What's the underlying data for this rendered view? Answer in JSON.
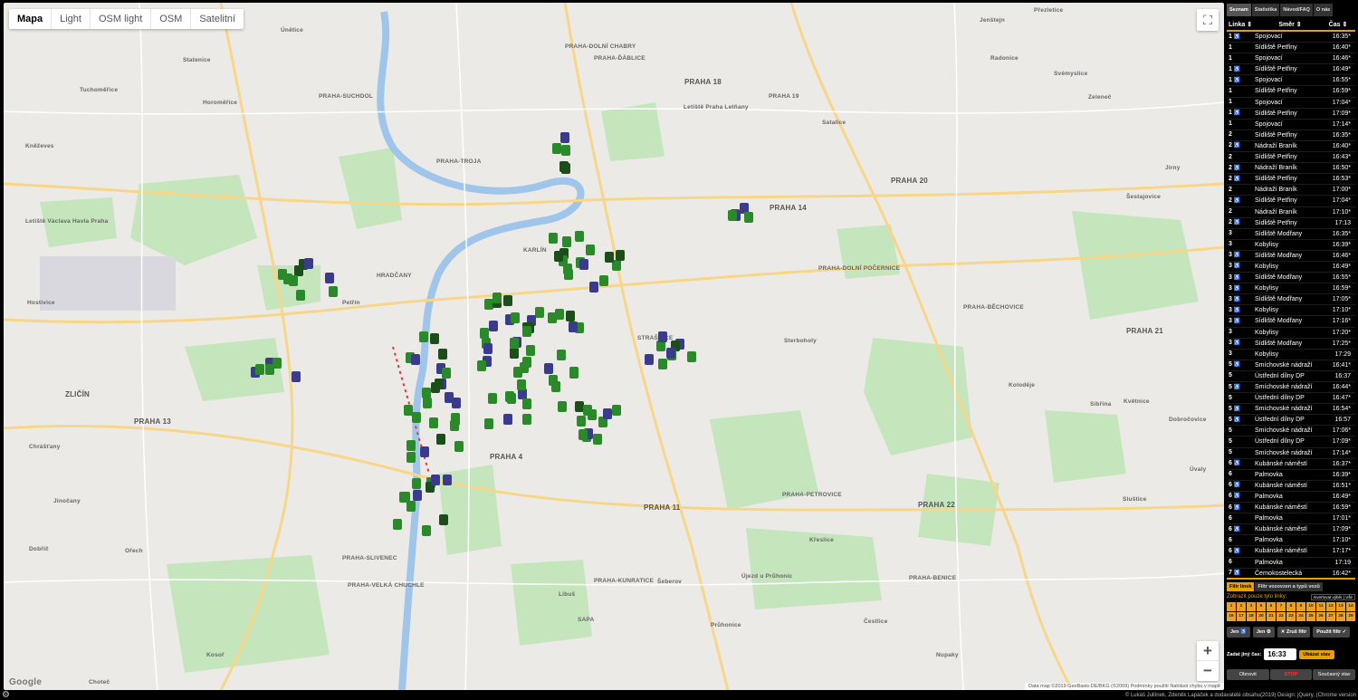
{
  "map": {
    "map_types": [
      "Mapa",
      "Light",
      "OSM light",
      "OSM",
      "Satelitní"
    ],
    "active_map_type": "Mapa",
    "zoom_in_label": "+",
    "zoom_out_label": "−",
    "google_label": "Google",
    "attribution": "Data map ©2019 GeoBasis-DE/BKG (©2009)   Podmínky použití   Nahlásit chybu v mapě",
    "places": [
      {
        "label": "PRAHA 18",
        "big": true
      },
      {
        "label": "PRAHA 20",
        "big": true
      },
      {
        "label": "PRAHA 14",
        "big": true
      },
      {
        "label": "PRAHA 21",
        "big": true
      },
      {
        "label": "PRAHA 22",
        "big": true
      },
      {
        "label": "PRAHA 4",
        "big": true
      },
      {
        "label": "PRAHA 11",
        "big": true
      },
      {
        "label": "PRAHA 13",
        "big": true
      },
      {
        "label": "PRAHA 19",
        "big": false
      },
      {
        "label": "PRAHA-TROJA",
        "big": false
      },
      {
        "label": "PRAHA-SUCHDOL",
        "big": false
      },
      {
        "label": "PRAHA-DOLNÍ CHABRY",
        "big": false
      },
      {
        "label": "PRAHA-ĎÁBLICE",
        "big": false
      },
      {
        "label": "PRAHA-DOLNÍ POČERNICE",
        "big": false
      },
      {
        "label": "PRAHA-BĚCHOVICE",
        "big": false
      },
      {
        "label": "PRAHA-PETROVICE",
        "big": false
      },
      {
        "label": "PRAHA-KUNRATICE",
        "big": false
      },
      {
        "label": "PRAHA-SLIVENEC",
        "big": false
      },
      {
        "label": "PRAHA-VELKÁ CHUCHLE",
        "big": false
      },
      {
        "label": "PRAHA-BENICE",
        "big": false
      },
      {
        "label": "ZLIČÍN",
        "big": true
      },
      {
        "label": "HRADČANY",
        "big": false
      },
      {
        "label": "Letiště Václava Havla Praha",
        "big": false
      },
      {
        "label": "Letiště Praha Letňany",
        "big": false
      },
      {
        "label": "Sterboholy",
        "big": false
      },
      {
        "label": "Koloděje",
        "big": false
      },
      {
        "label": "Sibřina",
        "big": false
      },
      {
        "label": "Květnice",
        "big": false
      },
      {
        "label": "Dobročovice",
        "big": false
      },
      {
        "label": "Šestajovice",
        "big": false
      },
      {
        "label": "Jirny",
        "big": false
      },
      {
        "label": "Zeleneč",
        "big": false
      },
      {
        "label": "Svémyslice",
        "big": false
      },
      {
        "label": "Přezletice",
        "big": false
      },
      {
        "label": "Jenštejn",
        "big": false
      },
      {
        "label": "Radonice",
        "big": false
      },
      {
        "label": "Úněticе",
        "big": false
      },
      {
        "label": "Statenice",
        "big": false
      },
      {
        "label": "Tuchoměřice",
        "big": false
      },
      {
        "label": "Horoměřice",
        "big": false
      },
      {
        "label": "Kněževes",
        "big": false
      },
      {
        "label": "Hostivice",
        "big": false
      },
      {
        "label": "Chrášťany",
        "big": false
      },
      {
        "label": "Jinočany",
        "big": false
      },
      {
        "label": "Dobříč",
        "big": false
      },
      {
        "label": "Ořech",
        "big": false
      },
      {
        "label": "Choteč",
        "big": false
      },
      {
        "label": "Kosoř",
        "big": false
      },
      {
        "label": "Libuš",
        "big": false
      },
      {
        "label": "Šeberov",
        "big": false
      },
      {
        "label": "Újezd u Průhonic",
        "big": false
      },
      {
        "label": "Průhonice",
        "big": false
      },
      {
        "label": "Čestlice",
        "big": false
      },
      {
        "label": "Nupaky",
        "big": false
      },
      {
        "label": "Křeslice",
        "big": false
      },
      {
        "label": "Sluštice",
        "big": false
      },
      {
        "label": "Úvaly",
        "big": false
      },
      {
        "label": "SAPA",
        "big": false
      },
      {
        "label": "KARLÍN",
        "big": false
      },
      {
        "label": "STRAŠNICE",
        "big": false
      },
      {
        "label": "Petřín",
        "big": false
      },
      {
        "label": "Satalice",
        "big": false
      }
    ]
  },
  "sidebar": {
    "tabs": [
      "Seznam",
      "Statistika",
      "Návod/FAQ",
      "O nás"
    ],
    "active_tab": "Seznam",
    "columns": {
      "line": "Linka ⇕",
      "direction": "Směr ⇕",
      "time": "Čas ⇕"
    },
    "rows": [
      {
        "line": "1",
        "wc": true,
        "dir": "Spojovací",
        "time": "16:35*"
      },
      {
        "line": "1",
        "wc": false,
        "dir": "Sídliště Petřiny",
        "time": "16:40*"
      },
      {
        "line": "1",
        "wc": false,
        "dir": "Spojovací",
        "time": "16:46*"
      },
      {
        "line": "1",
        "wc": true,
        "dir": "Sídliště Petřiny",
        "time": "16:49*"
      },
      {
        "line": "1",
        "wc": true,
        "dir": "Spojovací",
        "time": "16:55*"
      },
      {
        "line": "1",
        "wc": false,
        "dir": "Sídliště Petřiny",
        "time": "16:59*"
      },
      {
        "line": "1",
        "wc": false,
        "dir": "Spojovací",
        "time": "17:04*"
      },
      {
        "line": "1",
        "wc": true,
        "dir": "Sídliště Petřiny",
        "time": "17:09*"
      },
      {
        "line": "1",
        "wc": false,
        "dir": "Spojovací",
        "time": "17:14*"
      },
      {
        "line": "2",
        "wc": false,
        "dir": "Sídliště Petřiny",
        "time": "16:35*"
      },
      {
        "line": "2",
        "wc": true,
        "dir": "Nádraží Braník",
        "time": "16:40*"
      },
      {
        "line": "2",
        "wc": false,
        "dir": "Sídliště Petřiny",
        "time": "16:43*"
      },
      {
        "line": "2",
        "wc": true,
        "dir": "Nádraží Braník",
        "time": "16:50*"
      },
      {
        "line": "2",
        "wc": true,
        "dir": "Sídliště Petřiny",
        "time": "16:53*"
      },
      {
        "line": "2",
        "wc": false,
        "dir": "Nádraží Braník",
        "time": "17:00*"
      },
      {
        "line": "2",
        "wc": true,
        "dir": "Sídliště Petřiny",
        "time": "17:04*"
      },
      {
        "line": "2",
        "wc": false,
        "dir": "Nádraží Braník",
        "time": "17:10*"
      },
      {
        "line": "2",
        "wc": true,
        "dir": "Sídliště Petřiny",
        "time": "17:13"
      },
      {
        "line": "3",
        "wc": false,
        "dir": "Sídliště Modřany",
        "time": "16:35*"
      },
      {
        "line": "3",
        "wc": false,
        "dir": "Kobylisy",
        "time": "16:39*"
      },
      {
        "line": "3",
        "wc": true,
        "dir": "Sídliště Modřany",
        "time": "16:46*"
      },
      {
        "line": "3",
        "wc": true,
        "dir": "Kobylisy",
        "time": "16:49*"
      },
      {
        "line": "3",
        "wc": true,
        "dir": "Sídliště Modřany",
        "time": "16:55*"
      },
      {
        "line": "3",
        "wc": true,
        "dir": "Kobylisy",
        "time": "16:59*"
      },
      {
        "line": "3",
        "wc": true,
        "dir": "Sídliště Modřany",
        "time": "17:05*"
      },
      {
        "line": "3",
        "wc": true,
        "dir": "Kobylisy",
        "time": "17:10*"
      },
      {
        "line": "3",
        "wc": true,
        "dir": "Sídliště Modřany",
        "time": "17:16*"
      },
      {
        "line": "3",
        "wc": false,
        "dir": "Kobylisy",
        "time": "17:20*"
      },
      {
        "line": "3",
        "wc": true,
        "dir": "Sídliště Modřany",
        "time": "17:25*"
      },
      {
        "line": "3",
        "wc": false,
        "dir": "Kobylisy",
        "time": "17:29"
      },
      {
        "line": "5",
        "wc": true,
        "dir": "Smíchovské nádraží",
        "time": "16:41*"
      },
      {
        "line": "5",
        "wc": false,
        "dir": "Ústřední dílny DP",
        "time": "16:37"
      },
      {
        "line": "5",
        "wc": true,
        "dir": "Smíchovské nádraží",
        "time": "16:44*"
      },
      {
        "line": "5",
        "wc": false,
        "dir": "Ústřední dílny DP",
        "time": "16:47*"
      },
      {
        "line": "5",
        "wc": true,
        "dir": "Smíchovské nádraží",
        "time": "16:54*"
      },
      {
        "line": "5",
        "wc": true,
        "dir": "Ústřední dílny DP",
        "time": "16:57"
      },
      {
        "line": "5",
        "wc": false,
        "dir": "Smíchovské nádraží",
        "time": "17:06*"
      },
      {
        "line": "5",
        "wc": false,
        "dir": "Ústřední dílny DP",
        "time": "17:09*"
      },
      {
        "line": "5",
        "wc": false,
        "dir": "Smíchovské nádraží",
        "time": "17:14*"
      },
      {
        "line": "6",
        "wc": true,
        "dir": "Kubánské náměstí",
        "time": "16:37*"
      },
      {
        "line": "6",
        "wc": false,
        "dir": "Palmovka",
        "time": "16:39*"
      },
      {
        "line": "6",
        "wc": true,
        "dir": "Kubánské náměstí",
        "time": "16:51*"
      },
      {
        "line": "6",
        "wc": true,
        "dir": "Palmovka",
        "time": "16:49*"
      },
      {
        "line": "6",
        "wc": true,
        "dir": "Kubánské náměstí",
        "time": "16:59*"
      },
      {
        "line": "6",
        "wc": false,
        "dir": "Palmovka",
        "time": "17:01*"
      },
      {
        "line": "6",
        "wc": true,
        "dir": "Kubánské náměstí",
        "time": "17:09*"
      },
      {
        "line": "6",
        "wc": false,
        "dir": "Palmovka",
        "time": "17:10*"
      },
      {
        "line": "6",
        "wc": true,
        "dir": "Kubánské náměstí",
        "time": "17:17*"
      },
      {
        "line": "6",
        "wc": false,
        "dir": "Palmovka",
        "time": "17:19"
      },
      {
        "line": "7",
        "wc": true,
        "dir": "Černokostelecká",
        "time": "16:42*"
      }
    ],
    "filter": {
      "tabs": [
        "Filtr linek",
        "Filtr vozovzen a typů vozů"
      ],
      "active_tab": "Filtr linek",
      "note": "Zobrazit pouze tyto linky:",
      "invert_label": "Invertovat výběr | Vše",
      "lines": [
        "1",
        "2",
        "3",
        "5",
        "6",
        "7",
        "8",
        "9",
        "10",
        "11",
        "12",
        "13",
        "14",
        "16",
        "17",
        "18",
        "20",
        "21",
        "22",
        "23",
        "24",
        "25",
        "26",
        "27",
        "28",
        "29"
      ],
      "buttons": {
        "only_wc": "Jen ♿",
        "only_other": "Jen ⚙",
        "clear": "✕ Zruš filtr",
        "apply": "Použít filtr ✓"
      }
    },
    "time_set": {
      "label": "Zadat jiný čas:",
      "value": "16:33",
      "show_label": "Ukázat stav"
    },
    "bottom": {
      "refresh": "Obnovit",
      "stop": "STOP",
      "current": "Současný stav"
    }
  },
  "footer": {
    "credits": "© Lukáš Jullínek, Zdeněk Lapáček a dodavatelé obsahu(2019)  Design: jQuery, (Chrome version"
  },
  "colors": {
    "accent": "#e8a000",
    "tram": "#2a8a2a",
    "bus": "#3b3b8e",
    "stop": "#ff3030"
  }
}
